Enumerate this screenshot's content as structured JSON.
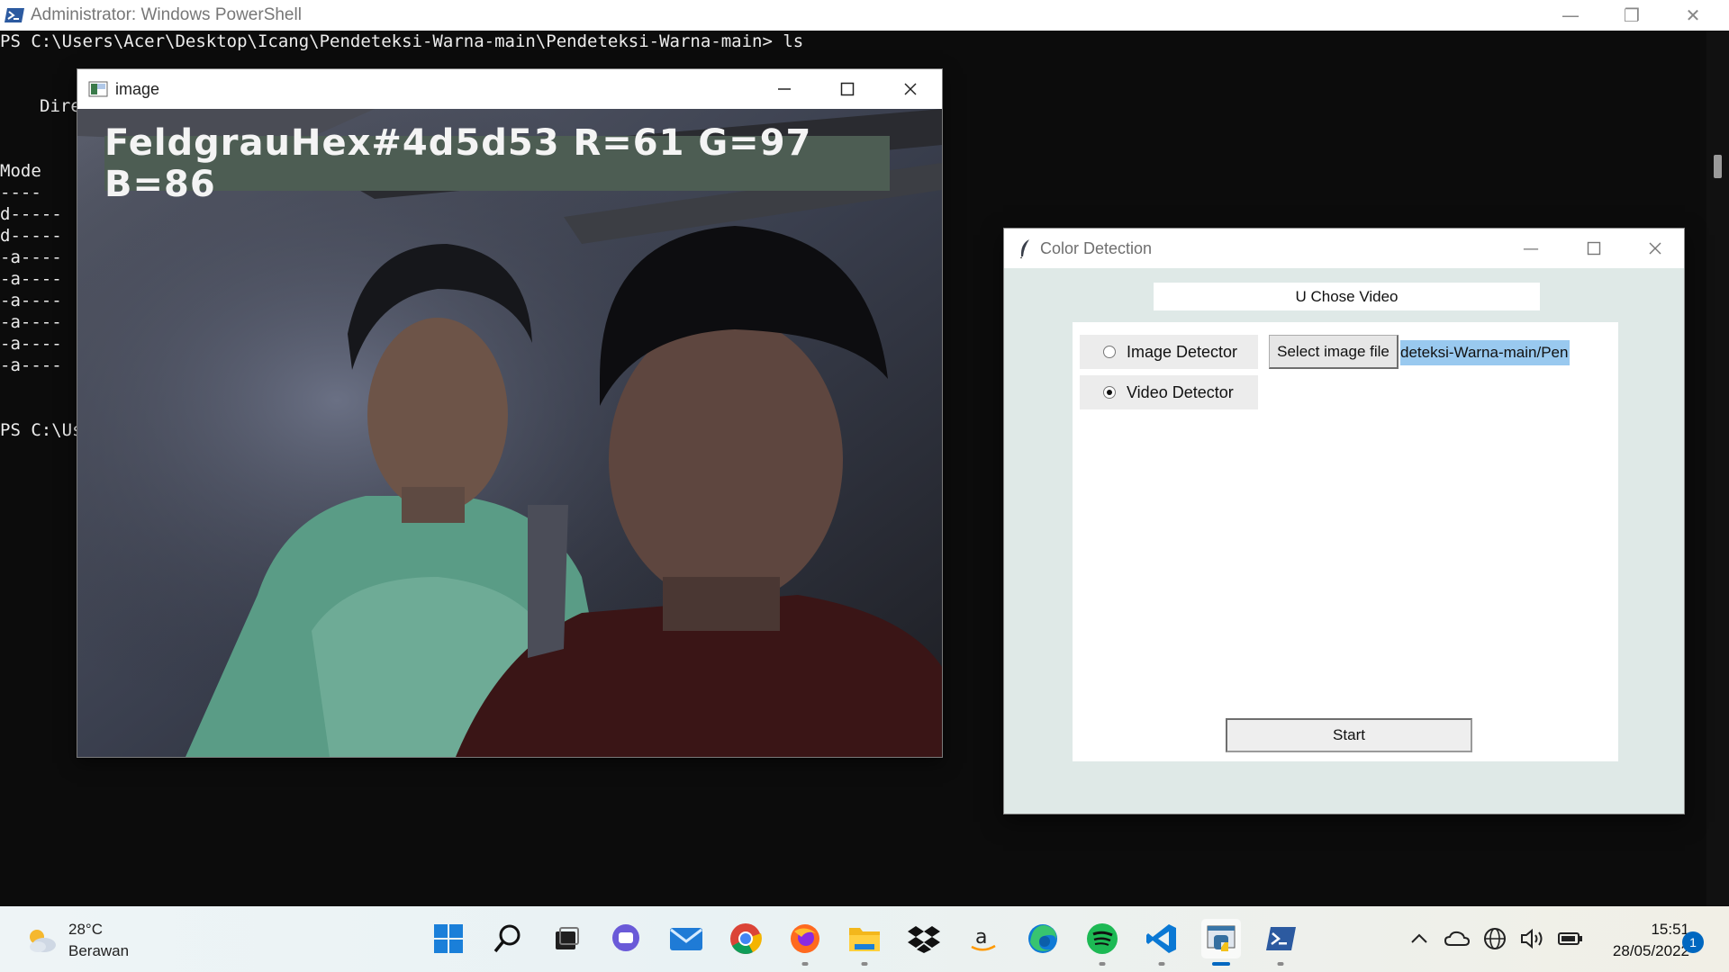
{
  "powershell": {
    "title": "Administrator: Windows PowerShell",
    "line1": "PS C:\\Users\\Acer\\Desktop\\Icang\\Pendeteksi-Warna-main\\Pendeteksi-Warna-main> ls",
    "dir_fragment": "Dire",
    "mode_header": "Mode",
    "mode_rule": "----",
    "mode_rows": [
      "d-----",
      "d-----",
      "-a----",
      "-a----",
      "-a----",
      "-a----",
      "-a----",
      "-a----"
    ],
    "prompt_fragment": "PS C:\\Us"
  },
  "image_window": {
    "title": "image",
    "overlay_text": "FeldgrauHex#4d5d53  R=61  G=97  B=86",
    "overlay_color": "#4d5d53"
  },
  "color_detection": {
    "title": "Color Detection",
    "header": "U Chose Video",
    "radio_image": "Image Detector",
    "radio_video": "Video Detector",
    "selected": "Video Detector",
    "select_button": "Select image file",
    "path_value": "deteksi-Warna-main/Pen",
    "start_button": "Start"
  },
  "taskbar": {
    "temperature": "28°C",
    "weather": "Berawan",
    "icons": [
      "windows-start",
      "search",
      "task-view",
      "teams-chat",
      "mail",
      "chrome",
      "firefox",
      "file-explorer",
      "dropbox",
      "amazon",
      "edge",
      "spotify",
      "vscode",
      "python-idle",
      "powershell"
    ],
    "time": "15:51",
    "date": "28/05/2022",
    "notifications": "1"
  }
}
